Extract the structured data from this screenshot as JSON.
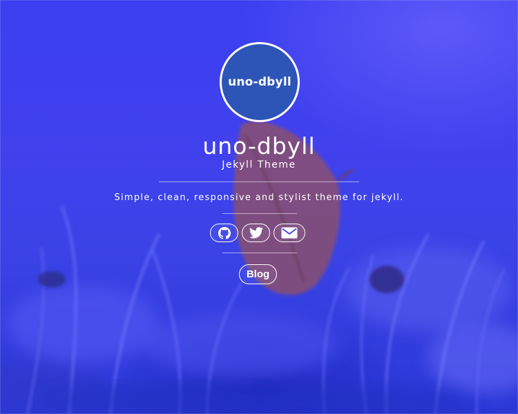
{
  "site": {
    "avatar_text": "uno-dbyll",
    "title": "uno-dbyll",
    "subtitle": "Jekyll Theme",
    "tagline": "Simple, clean, responsive and stylist theme for jekyll."
  },
  "social": [
    {
      "icon": "github-icon",
      "label": "GitHub"
    },
    {
      "icon": "twitter-icon",
      "label": "Twitter"
    },
    {
      "icon": "envelope-icon",
      "label": "Email"
    }
  ],
  "nav": {
    "blog_label": "Blog"
  },
  "colors": {
    "background": "#3f41ea",
    "avatar_fill": "#2d55b8",
    "foreground": "#ffffff"
  }
}
